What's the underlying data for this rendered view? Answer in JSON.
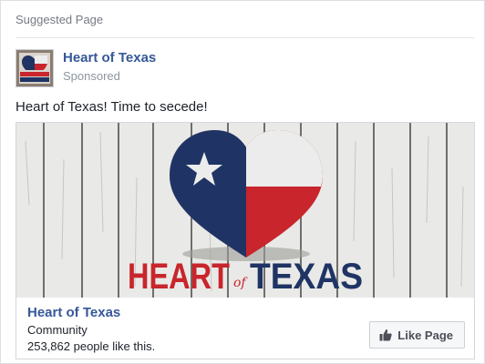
{
  "header": {
    "label": "Suggested Page"
  },
  "post": {
    "page_name": "Heart of Texas",
    "sponsored_label": "Sponsored",
    "text": "Heart of Texas! Time to secede!",
    "avatar_logo_text": "HEART TEXAS"
  },
  "attachment": {
    "banner_text_heart": "HEART",
    "banner_text_of": "of",
    "banner_text_texas": "TEXAS",
    "title": "Heart of Texas",
    "category": "Community",
    "likes": "253,862 people like this."
  },
  "actions": {
    "like_page_label": "Like Page"
  },
  "colors": {
    "link_blue": "#365899",
    "flag_blue": "#1f3464",
    "flag_red": "#c8252c",
    "flag_white": "#ececec"
  },
  "icons": [
    "star-icon",
    "thumbs-up-icon"
  ]
}
